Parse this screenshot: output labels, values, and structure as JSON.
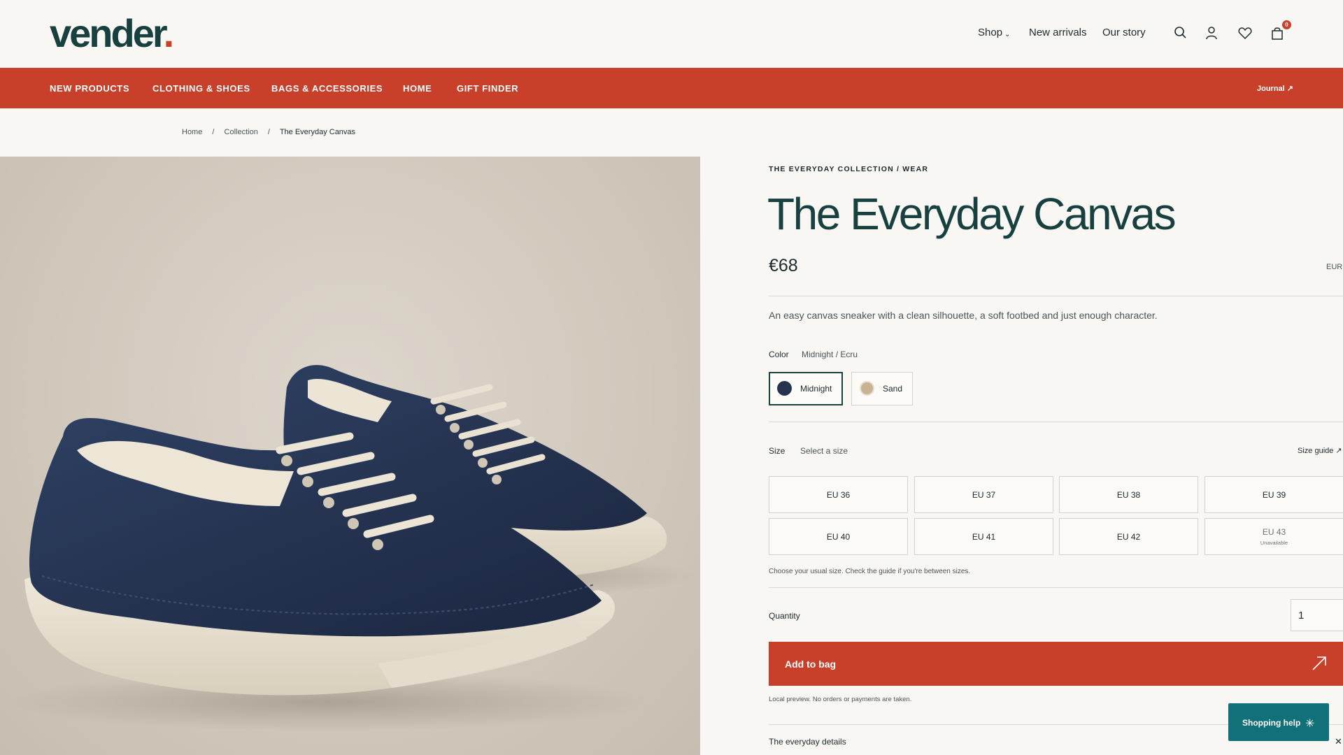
{
  "header": {
    "logo_text": "vender",
    "logo_dot": ".",
    "nav": [
      {
        "label": "Shop"
      },
      {
        "label": "New arrivals"
      },
      {
        "label": "Our story"
      }
    ],
    "bag_count": "0",
    "icons": [
      "search-icon",
      "account-icon",
      "heart-icon",
      "bag-icon"
    ]
  },
  "categories": [
    "NEW PRODUCTS",
    "CLOTHING & SHOES",
    "BAGS & ACCESSORIES",
    "HOME",
    "GIFT FINDER"
  ],
  "journal_label": "Journal ↗",
  "breadcrumb": [
    {
      "label": "Home"
    },
    {
      "label": "Collection"
    },
    {
      "label": "The Everyday Canvas"
    }
  ],
  "product": {
    "eyebrow": "THE EVERYDAY COLLECTION / WEAR",
    "title": "The Everyday Canvas",
    "price": "€68",
    "currency": "EUR",
    "description": "An easy canvas sneaker with a clean silhouette, a soft footbed and just enough character.",
    "color_label": "Color",
    "color_value": "Midnight / Ecru",
    "colors": [
      {
        "label": "Midnight",
        "hex": "#25334d",
        "selected": true
      },
      {
        "label": "Sand",
        "hex": "#c9b193",
        "selected": false
      }
    ],
    "size_label": "Size",
    "size_value": "Select a size",
    "size_guide": "Size guide ↗",
    "sizes": [
      {
        "label": "EU 36"
      },
      {
        "label": "EU 37"
      },
      {
        "label": "EU 38"
      },
      {
        "label": "EU 39"
      },
      {
        "label": "EU 40"
      },
      {
        "label": "EU 41"
      },
      {
        "label": "EU 42"
      },
      {
        "label": "EU 43",
        "status": "Unavailable"
      }
    ],
    "size_hint": "Choose your usual size. Check the guide if you're between sizes.",
    "quantity_label": "Quantity",
    "quantity": "1",
    "add_to_bag": "Add to bag",
    "note": "Local preview. No orders or payments are taken.",
    "details_label": "The everyday details"
  },
  "help_widget": {
    "label": "Shopping help"
  },
  "colors": {
    "brand_red": "#c8402a",
    "brand_green": "#17403f",
    "help_teal": "#117078",
    "background": "#f9f7f3"
  }
}
